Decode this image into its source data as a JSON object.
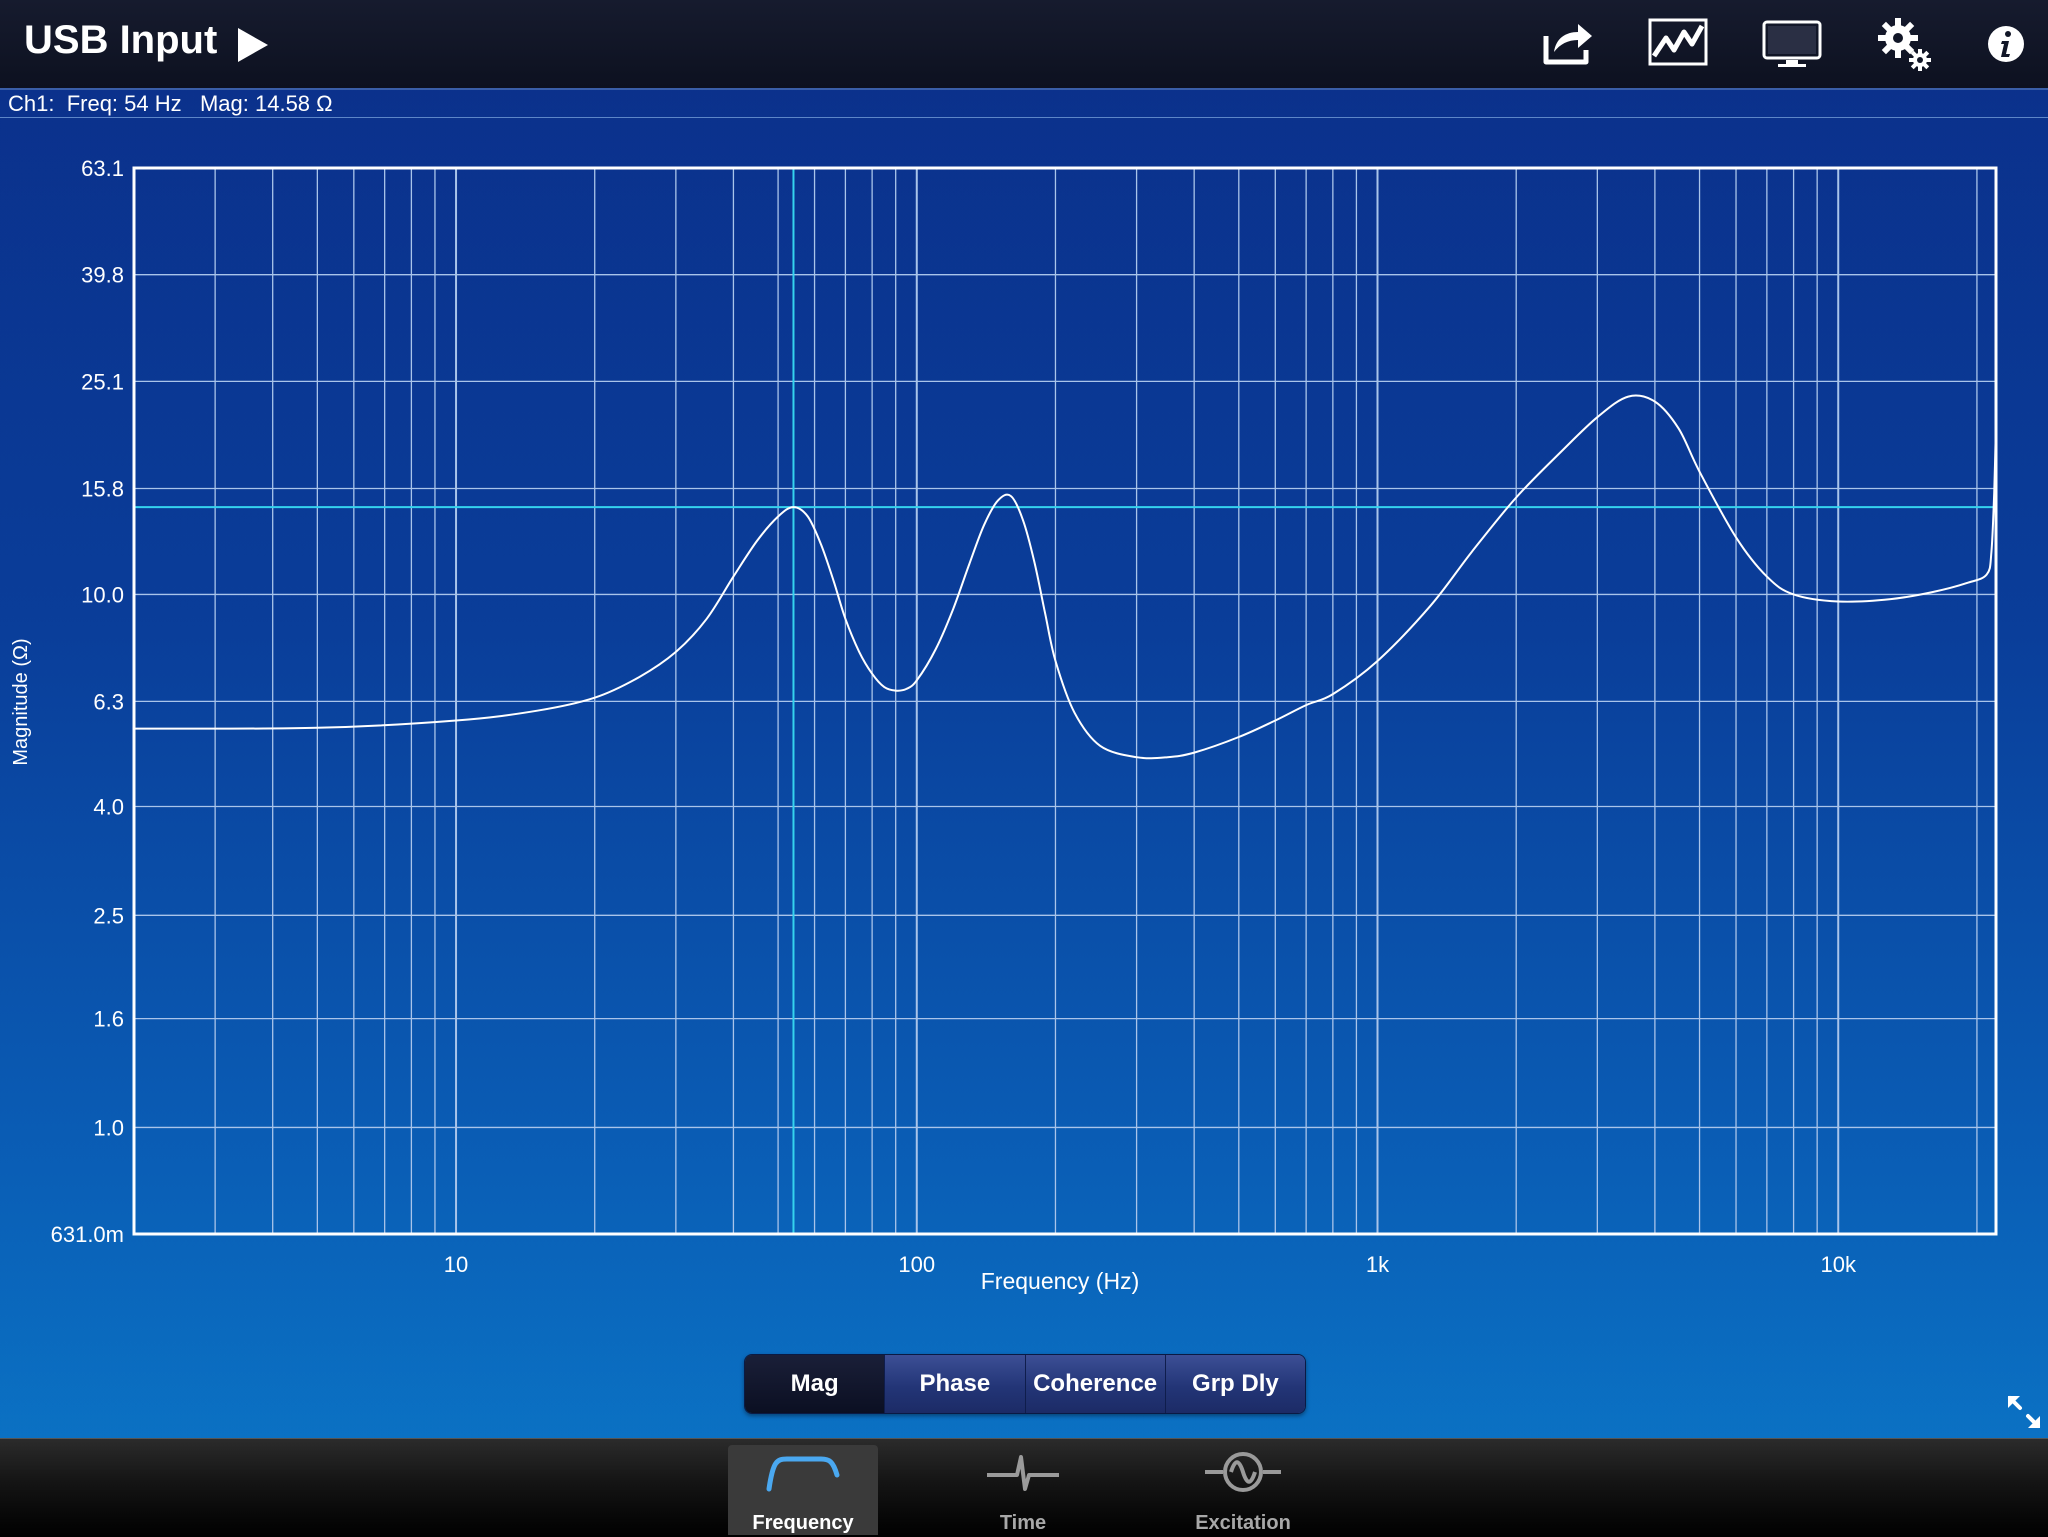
{
  "header": {
    "title": "USB Input",
    "icons": [
      "play-icon",
      "share-icon",
      "trace-icon",
      "display-icon",
      "settings-icon",
      "info-icon"
    ]
  },
  "readout": {
    "text": "Ch1:  Freq: 54 Hz   Mag: 14.58 Ω"
  },
  "chart_data": {
    "type": "line",
    "x_scale": "log",
    "y_scale": "log",
    "xlabel": "Frequency (Hz)",
    "ylabel": "Magnitude (Ω)",
    "xlim": [
      2,
      22000
    ],
    "ylim": [
      0.631,
      63.1
    ],
    "x_tick_labels": [
      {
        "value": 10,
        "label": "10"
      },
      {
        "value": 100,
        "label": "100"
      },
      {
        "value": 1000,
        "label": "1k"
      },
      {
        "value": 10000,
        "label": "10k"
      }
    ],
    "y_tick_labels": [
      {
        "value": 63.1,
        "label": "63.1"
      },
      {
        "value": 39.8,
        "label": "39.8"
      },
      {
        "value": 25.1,
        "label": "25.1"
      },
      {
        "value": 15.8,
        "label": "15.8"
      },
      {
        "value": 10.0,
        "label": "10.0"
      },
      {
        "value": 6.3,
        "label": "6.3"
      },
      {
        "value": 4.0,
        "label": "4.0"
      },
      {
        "value": 2.5,
        "label": "2.5"
      },
      {
        "value": 1.6,
        "label": "1.6"
      },
      {
        "value": 1.0,
        "label": "1.0"
      },
      {
        "value": 0.631,
        "label": "631.0m"
      }
    ],
    "grid": true,
    "cursor": {
      "x": 54,
      "y": 14.58
    },
    "series": [
      {
        "color": "#ffffff",
        "x": [
          2,
          5,
          10,
          15,
          20,
          25,
          30,
          35,
          40,
          45,
          50,
          54,
          58,
          62,
          66,
          70,
          75,
          80,
          85,
          90,
          95,
          100,
          110,
          120,
          130,
          140,
          150,
          160,
          170,
          180,
          190,
          200,
          220,
          250,
          300,
          350,
          400,
          500,
          600,
          700,
          800,
          1000,
          1300,
          1600,
          2000,
          2500,
          3000,
          3500,
          4000,
          4500,
          5000,
          6000,
          7000,
          8000,
          10000,
          13000,
          16000,
          19000,
          21000,
          21500,
          21800,
          22000
        ],
        "y": [
          5.6,
          5.62,
          5.8,
          6.05,
          6.4,
          7.0,
          7.8,
          9.0,
          10.8,
          12.6,
          14.0,
          14.58,
          14.0,
          12.4,
          10.6,
          9.0,
          7.8,
          7.1,
          6.7,
          6.6,
          6.65,
          6.9,
          7.9,
          9.4,
          11.4,
          13.5,
          15.0,
          15.3,
          13.8,
          11.5,
          9.2,
          7.5,
          6.0,
          5.2,
          4.95,
          4.95,
          5.05,
          5.4,
          5.8,
          6.2,
          6.5,
          7.5,
          9.5,
          12.0,
          15.2,
          18.5,
          21.5,
          23.5,
          23.0,
          20.5,
          17.0,
          12.8,
          10.8,
          10.0,
          9.7,
          9.8,
          10.1,
          10.5,
          10.9,
          12.0,
          15.5,
          21.0
        ]
      }
    ]
  },
  "segments": {
    "items": [
      {
        "label": "Mag",
        "active": true
      },
      {
        "label": "Phase",
        "active": false
      },
      {
        "label": "Coherence",
        "active": false
      },
      {
        "label": "Grp Dly",
        "active": false
      }
    ]
  },
  "tabbar": {
    "items": [
      {
        "label": "Frequency",
        "icon": "frequency-icon",
        "active": true
      },
      {
        "label": "Time",
        "icon": "time-icon",
        "active": false
      },
      {
        "label": "Excitation",
        "icon": "excitation-icon",
        "active": false
      }
    ]
  },
  "colors": {
    "cursor": "#35d3ee",
    "grid": "#a9c4ea",
    "header_bg": "#111627"
  }
}
